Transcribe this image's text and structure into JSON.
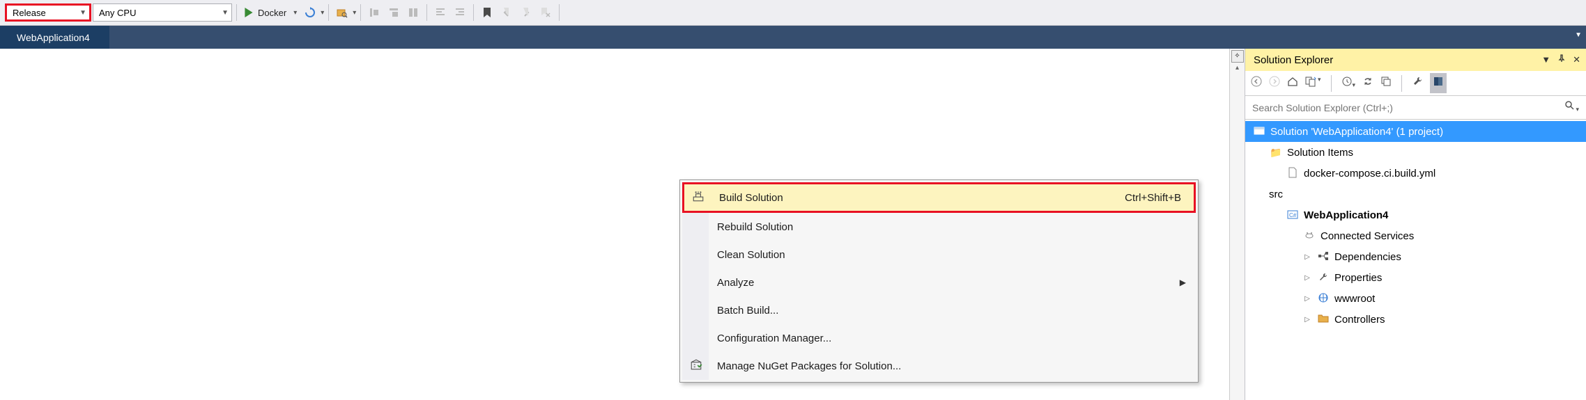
{
  "toolbar": {
    "config": "Release",
    "platform": "Any CPU",
    "run_label": "Docker"
  },
  "tab": {
    "active": "WebApplication4"
  },
  "context_menu": {
    "items": [
      {
        "label": "Build Solution",
        "shortcut": "Ctrl+Shift+B",
        "icon": "build",
        "highlight": true
      },
      {
        "label": "Rebuild Solution"
      },
      {
        "label": "Clean Solution"
      },
      {
        "label": "Analyze",
        "submenu": true
      },
      {
        "label": "Batch Build..."
      },
      {
        "label": "Configuration Manager..."
      },
      {
        "label": "Manage NuGet Packages for Solution...",
        "icon": "nuget"
      }
    ]
  },
  "solution_explorer": {
    "title": "Solution Explorer",
    "search_placeholder": "Search Solution Explorer (Ctrl+;)",
    "root": "Solution 'WebApplication4' (1 project)",
    "nodes": {
      "solution_items": "Solution Items",
      "docker_yml": "docker-compose.ci.build.yml",
      "src": "src",
      "project": "WebApplication4",
      "connected": "Connected Services",
      "deps": "Dependencies",
      "props": "Properties",
      "wwwroot": "wwwroot",
      "controllers": "Controllers"
    }
  }
}
